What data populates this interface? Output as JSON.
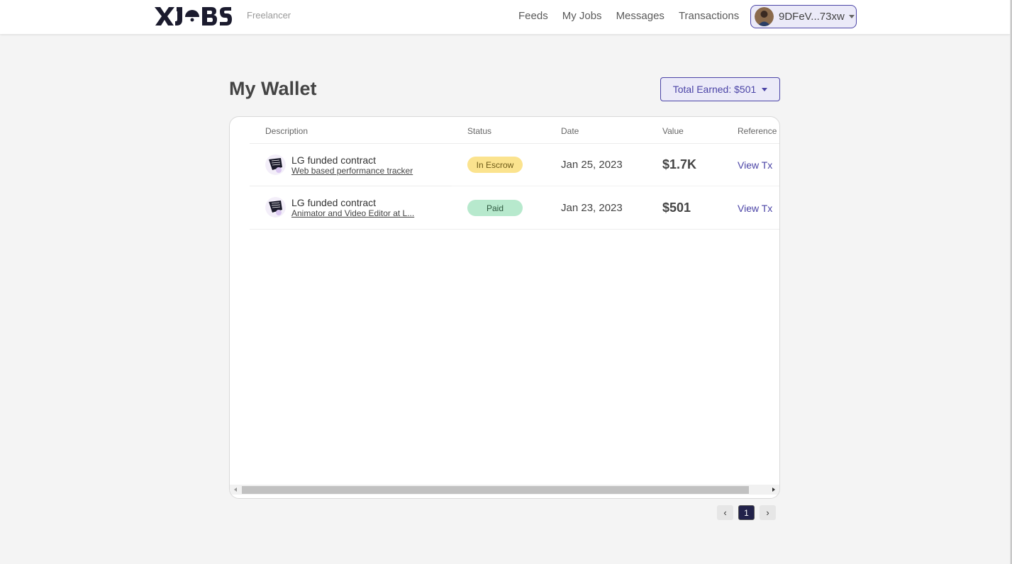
{
  "header": {
    "brand_sub": "Freelancer",
    "nav": [
      "Feeds",
      "My Jobs",
      "Messages",
      "Transactions"
    ],
    "account_label": "9DFeV...73xw"
  },
  "page": {
    "title": "My Wallet",
    "total_earned": "Total Earned: $501"
  },
  "table": {
    "columns": [
      "Description",
      "Status",
      "Date",
      "Value",
      "Reference"
    ],
    "rows": [
      {
        "title": "LG funded contract",
        "subtitle": "Web based performance tracker",
        "status": "In Escrow",
        "date": "Jan 25, 2023",
        "value": "$1.7K",
        "reference": "View Tx"
      },
      {
        "title": "LG funded contract",
        "subtitle": "Animator and Video Editor at L...",
        "status": "Paid",
        "date": "Jan 23, 2023",
        "value": "$501",
        "reference": "View Tx"
      }
    ]
  },
  "pagination": {
    "prev": "‹",
    "current": "1",
    "next": "›"
  },
  "colors": {
    "accent": "#4b44a6",
    "escrow": "#fbe38e",
    "paid": "#b7e9cd"
  }
}
